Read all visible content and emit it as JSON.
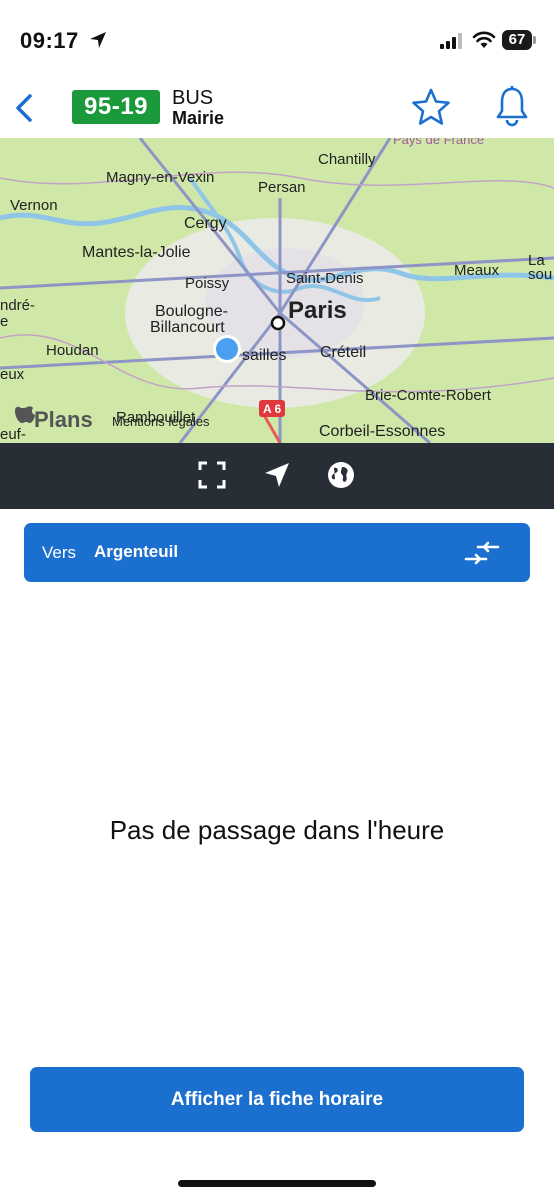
{
  "status_bar": {
    "time": "09:17",
    "battery": "67"
  },
  "header": {
    "line_number": "95-19",
    "mode": "BUS",
    "stop_name": "Mairie",
    "line_color": "#1a9a3b"
  },
  "map": {
    "labels": [
      "Chantilly",
      "Pays de France",
      "Magny-en-Vexin",
      "Persan",
      "Vernon",
      "Cergy",
      "Mantes-la-Jolie",
      "Meaux",
      "La",
      "sou",
      "Poissy",
      "Saint-Denis",
      "Paris",
      "ndré-",
      "e",
      "Boulogne-",
      "Billancourt",
      "Houdan",
      "sailles",
      "Créteil",
      "eux",
      "Brie-Comte-Robert",
      "Rambouillet",
      "Mentions légales",
      "A 6",
      "Corbeil-Essonnes",
      "euf-",
      "Plans"
    ]
  },
  "direction": {
    "prefix": "Vers",
    "destination": "Argenteuil"
  },
  "empty_message": "Pas de passage dans l'heure",
  "timetable_button": "Afficher la fiche horaire",
  "accent_color": "#1b6fce"
}
